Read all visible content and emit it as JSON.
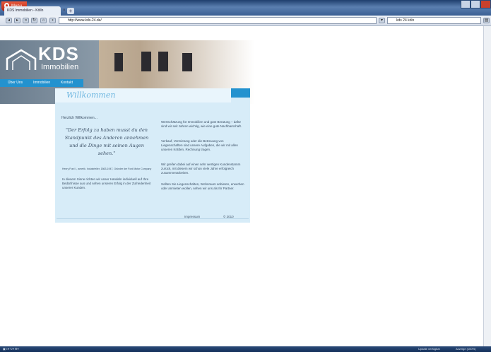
{
  "browser": {
    "menu_label": "Menu",
    "tab_title": "KDS Immobilien - Kölln",
    "tab_close": "×",
    "new_tab": "+",
    "url": "http://www.kds-24.de/",
    "search_value": "kds 24 köln",
    "status_update": "Update verfügbar",
    "status_zoom": "Anzeige (100%)"
  },
  "site": {
    "logo_title": "KDS",
    "logo_subtitle": "Immobilien",
    "nav": [
      "Über Uns",
      "Immobilien",
      "Kontakt"
    ],
    "welcome_heading": "Willkommen",
    "greeting": "Herzlich Willkommen...",
    "quote": "\"Der Erfolg zu haben musst du den Standpunkt des Anderen annehmen und die Dinge mit seinen Augen sehen.\"",
    "quote_author": "Henry Ford I., amerik. Industrieller, 1863-1947, Gründer der Ford Motor Company",
    "left_para": "In diesem Sinne richten wir unser Handeln individuell auf Ihre Bedürfnisse aus und sehen unseren Erfolg in der Zufriedenheit unserer Kunden.",
    "right_para1": "Wertschätzung für Immobilien und gute Beratung – dafür sind wir seit Jahren wichtig, wie eine gute Nachbarschaft.",
    "right_para2": "Verkauf, Vermietung oder die Betreuung von Liegenschaften sind unsere Aufgaben, die wir mit allen unseren Kräften, Rechnung tragen.",
    "right_para3": "Wir greifen dabei auf einen sehr wertigen Kundenstamm zurück, mit diesem wir schon viele Jahre erfolgreich zusammenarbeiten.",
    "right_para4": "Sollten Sie Liegenschaften, Wohnraum anbieten, erwerben oder anmieten wollen, sehen wir uns als Ihr Partner.",
    "footer_impressum": "Impressum",
    "footer_copyright": "© 2010"
  }
}
